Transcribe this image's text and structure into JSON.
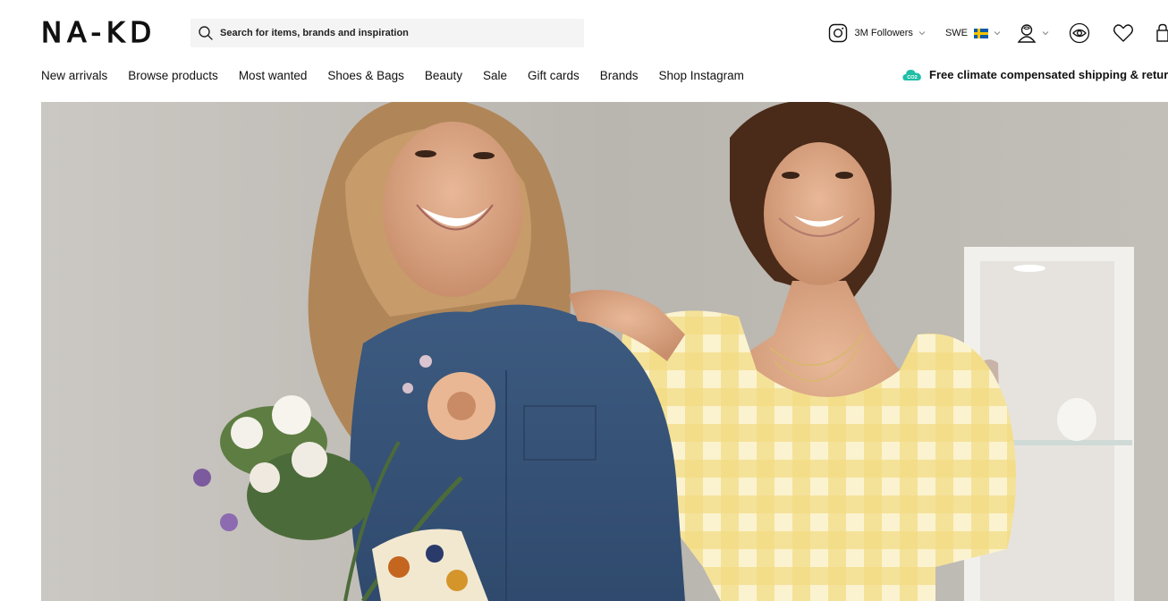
{
  "brand": {
    "logo_text": "NA-KD"
  },
  "search": {
    "placeholder": "Search for items, brands and inspiration"
  },
  "utility": {
    "instagram_followers": "3M Followers",
    "country": "SWE"
  },
  "nav": {
    "items": [
      {
        "label": "New arrivals"
      },
      {
        "label": "Browse products"
      },
      {
        "label": "Most wanted"
      },
      {
        "label": "Shoes & Bags"
      },
      {
        "label": "Beauty"
      },
      {
        "label": "Sale"
      },
      {
        "label": "Gift cards"
      },
      {
        "label": "Brands"
      },
      {
        "label": "Shop Instagram"
      }
    ]
  },
  "promo": {
    "badge": "CO2",
    "text": "Free climate compensated shipping & returns"
  },
  "colors": {
    "accent_promo": "#1fbfa6",
    "flag_blue": "#0a5aa6",
    "flag_yellow": "#f5c400"
  },
  "icons": [
    "search-icon",
    "instagram-icon",
    "chevron-down-icon",
    "user-icon",
    "eye-icon",
    "heart-icon",
    "cart-icon"
  ]
}
